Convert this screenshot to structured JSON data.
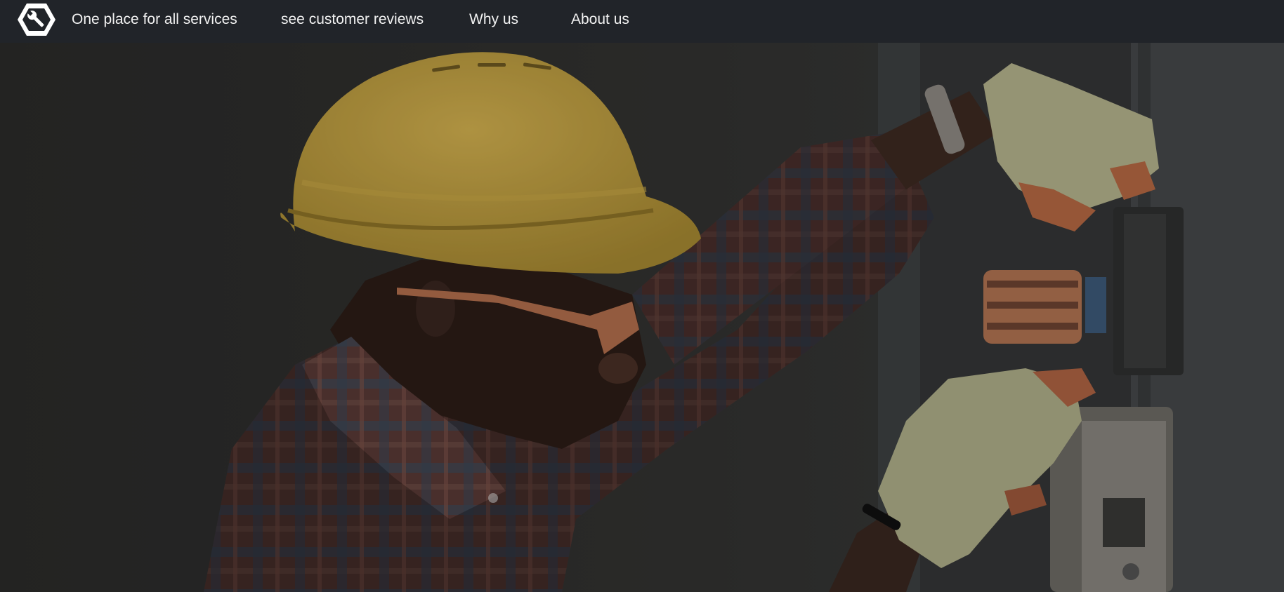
{
  "navbar": {
    "logo_icon": "wrench-hexagon-icon",
    "links": [
      {
        "label": "One place for all services"
      },
      {
        "label": "see customer reviews"
      },
      {
        "label": "Why us"
      },
      {
        "label": "About us"
      }
    ],
    "background": "#212429",
    "text_color": "#f1f1f1"
  },
  "hero": {
    "image_subject": "electrician in yellow hard hat and plaid shirt working on an electrical box",
    "overlay": "dark"
  }
}
